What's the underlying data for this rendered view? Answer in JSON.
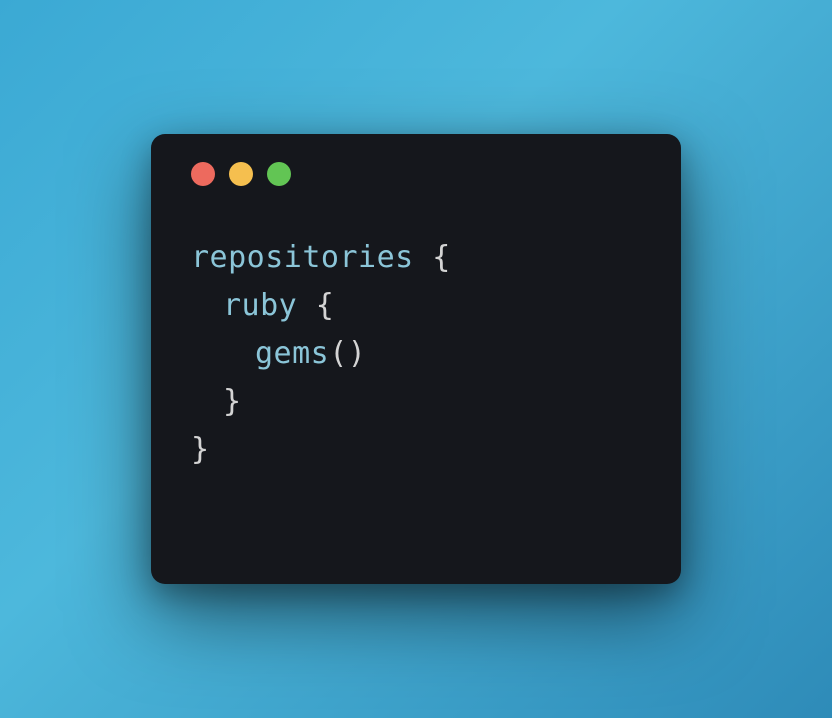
{
  "code": {
    "line1": {
      "identifier": "repositories",
      "brace": " {"
    },
    "line2": {
      "identifier": "ruby",
      "brace": " {"
    },
    "line3": {
      "identifier": "gems",
      "parens": "()"
    },
    "line4": {
      "brace": "}"
    },
    "line5": {
      "brace": "}"
    }
  }
}
